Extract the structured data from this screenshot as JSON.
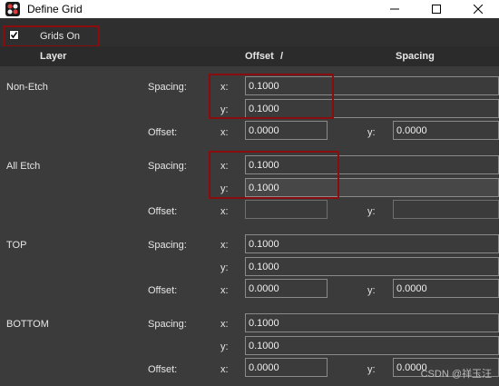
{
  "window": {
    "title": "Define Grid",
    "minimize_icon": "minimize-icon",
    "maximize_icon": "maximize-icon",
    "close_icon": "close-icon"
  },
  "toolbar": {
    "grids_on_label": "Grids On",
    "grids_on_checked": true
  },
  "header": {
    "layer": "Layer",
    "offset": "Offset",
    "slash": "/",
    "spacing": "Spacing"
  },
  "labels": {
    "spacing": "Spacing:",
    "offset": "Offset:",
    "x": "x:",
    "y": "y:"
  },
  "layers": [
    {
      "name": "Non-Etch",
      "spacing_x": "0.1000",
      "spacing_y": "0.1000",
      "offset_x": "0.0000",
      "offset_y": "0.0000"
    },
    {
      "name": "All Etch",
      "spacing_x": "0.1000",
      "spacing_y": "0.1000",
      "offset_x": "",
      "offset_y": ""
    },
    {
      "name": "TOP",
      "spacing_x": "0.1000",
      "spacing_y": "0.1000",
      "offset_x": "0.0000",
      "offset_y": "0.0000"
    },
    {
      "name": "BOTTOM",
      "spacing_x": "0.1000",
      "spacing_y": "0.1000",
      "offset_x": "0.0000",
      "offset_y": "0.0000"
    }
  ],
  "watermark": "CSDN @祥玉汪",
  "colors": {
    "background": "#3b3b3b",
    "highlight": "#8b0c0c",
    "header_bg": "#2b2b2b"
  }
}
